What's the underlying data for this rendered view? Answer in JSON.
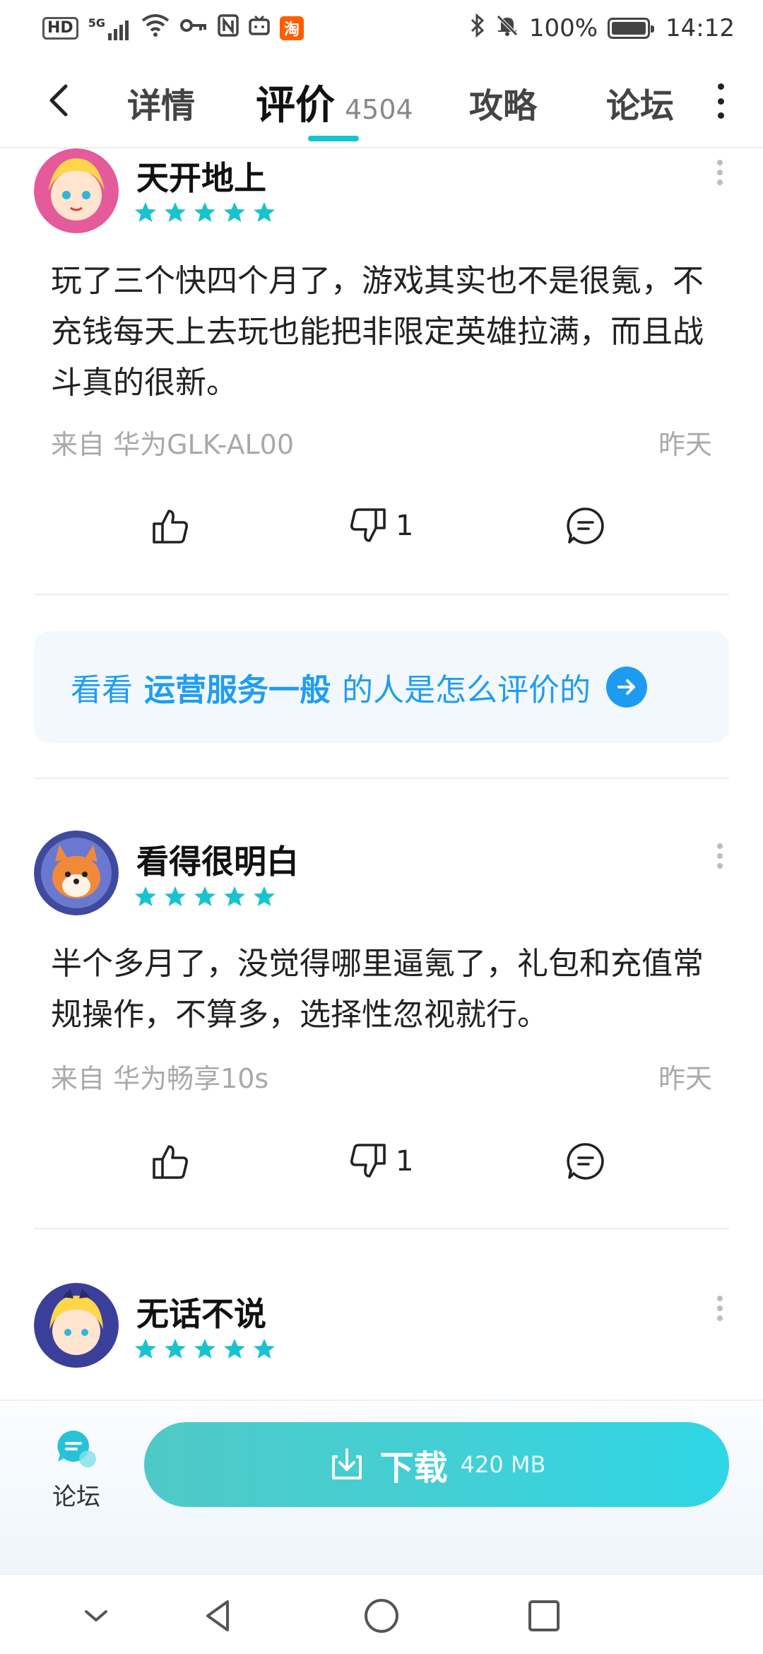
{
  "status_bar": {
    "network_label": "HD",
    "network_type": "5G",
    "taobao_glyph": "淘",
    "battery_text": "100%",
    "battery_level": 1.0,
    "time": "14:12"
  },
  "nav": {
    "tabs": [
      {
        "label": "详情"
      },
      {
        "label": "评价",
        "count": "4504",
        "active": true
      },
      {
        "label": "攻略"
      },
      {
        "label": "论坛"
      }
    ]
  },
  "reviews": [
    {
      "name": "天开地上",
      "rating": 5,
      "text": "玩了三个快四个月了，游戏其实也不是很氪，不充钱每天上去玩也能把非限定英雄拉满，而且战斗真的很新。",
      "source": "来自 华为GLK-AL00",
      "date": "昨天",
      "dislike_count": "1"
    },
    {
      "name": "看得很明白",
      "rating": 5,
      "text": "半个多月了，没觉得哪里逼氪了，礼包和充值常规操作，不算多，选择性忽视就行。",
      "source": "来自 华为畅享10s",
      "date": "昨天",
      "dislike_count": "1"
    },
    {
      "name": "无话不说",
      "rating": 5
    }
  ],
  "tag_banner": {
    "prefix": "看看",
    "tag": "运营服务一般",
    "suffix": "的人是怎么评价的"
  },
  "bottom_bar": {
    "forum_label": "论坛",
    "download_label": "下载",
    "download_size": "420 MB"
  },
  "colors": {
    "accent": "#15c5ce",
    "star": "#19c2cf",
    "link_blue": "#1f9df0"
  }
}
